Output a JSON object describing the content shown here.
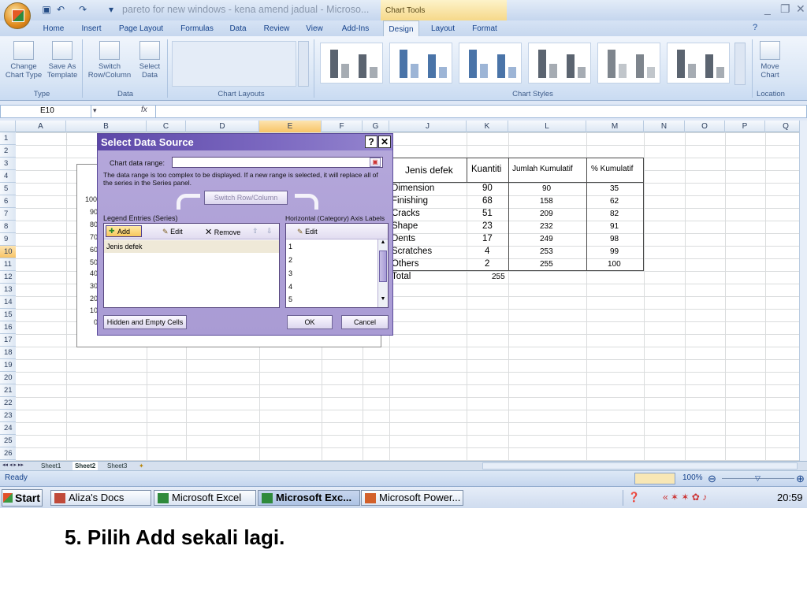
{
  "titlebar": {
    "doc_title": "pareto for new windows - kena amend jadual - Microso...",
    "contextual_tab_group": "Chart Tools",
    "minimize": "_",
    "restore": "❐",
    "close": "✕"
  },
  "tabs": [
    "Home",
    "Insert",
    "Page Layout",
    "Formulas",
    "Data",
    "Review",
    "View",
    "Add-Ins",
    "Design",
    "Layout",
    "Format"
  ],
  "active_tab": "Design",
  "ribbon": {
    "type_group": {
      "label": "Type",
      "change_chart_type": "Change Chart Type",
      "save_as_template": "Save As Template"
    },
    "data_group": {
      "label": "Data",
      "switch_row_column": "Switch Row/Column",
      "select_data": "Select Data"
    },
    "chart_layouts_label": "Chart Layouts",
    "chart_styles_label": "Chart Styles",
    "location_group": {
      "label": "Location",
      "move_chart": "Move Chart"
    }
  },
  "formula_bar": {
    "name_box": "E10",
    "fx": "fx"
  },
  "columns": [
    "A",
    "B",
    "C",
    "D",
    "E",
    "F",
    "G",
    "J",
    "K",
    "L",
    "M",
    "N",
    "O",
    "P",
    "Q"
  ],
  "selected_column": "E",
  "rows": [
    "1",
    "2",
    "3",
    "4",
    "5",
    "6",
    "7",
    "8",
    "9",
    "10",
    "11",
    "12",
    "13",
    "14",
    "15",
    "16",
    "17",
    "18",
    "19",
    "20",
    "21",
    "22",
    "23",
    "24",
    "25",
    "26"
  ],
  "selected_row": "10",
  "table": {
    "headers": {
      "defect": "Jenis defek",
      "qty": "Kuantiti",
      "cum": "Jumlah Kumulatif",
      "pct": "% Kumulatif"
    },
    "rows": [
      {
        "defect": "Dimension",
        "qty": "90",
        "cum": "90",
        "pct": "35"
      },
      {
        "defect": "Finishing",
        "qty": "68",
        "cum": "158",
        "pct": "62"
      },
      {
        "defect": "Cracks",
        "qty": "51",
        "cum": "209",
        "pct": "82"
      },
      {
        "defect": "Shape",
        "qty": "23",
        "cum": "232",
        "pct": "91"
      },
      {
        "defect": "Dents",
        "qty": "17",
        "cum": "249",
        "pct": "98"
      },
      {
        "defect": "Scratches",
        "qty": "4",
        "cum": "253",
        "pct": "99"
      },
      {
        "defect": "Others",
        "qty": "2",
        "cum": "255",
        "pct": "100"
      }
    ],
    "total_label": "Total",
    "total_value": "255"
  },
  "chart_axis_ticks": [
    "100",
    "90",
    "80",
    "70",
    "60",
    "50",
    "40",
    "30",
    "20",
    "10",
    "0"
  ],
  "dialog": {
    "title": "Select Data Source",
    "help": "?",
    "close": "✕",
    "range_label": "Chart data range:",
    "range_value": "",
    "range_message": "The data range is too complex to be displayed. If a new range is selected, it will replace all of the series in the Series panel.",
    "switch_button": "Switch Row/Column",
    "legend_label": "Legend Entries (Series)",
    "add": "Add",
    "edit": "Edit",
    "remove": "Remove",
    "series": [
      "Jenis defek"
    ],
    "axis_label": "Horizontal (Category) Axis Labels",
    "axis_edit": "Edit",
    "axis_items": [
      "1",
      "2",
      "3",
      "4",
      "5"
    ],
    "hidden_empty": "Hidden and Empty Cells",
    "ok": "OK",
    "cancel": "Cancel"
  },
  "sheets": [
    "Sheet1",
    "Sheet2",
    "Sheet3"
  ],
  "active_sheet": "Sheet2",
  "status": {
    "ready": "Ready",
    "zoom": "100%"
  },
  "taskbar": {
    "start": "Start",
    "tasks": [
      "Aliza's Docs",
      "Microsoft Excel",
      "Microsoft Exc...",
      "Microsoft Power..."
    ],
    "clock": "20:59"
  },
  "caption": "5. Pilih Add sekali lagi.",
  "colors": {
    "accent": "#5d48a8",
    "selection": "#f8c467",
    "ribbon": "#dfe8f6"
  }
}
